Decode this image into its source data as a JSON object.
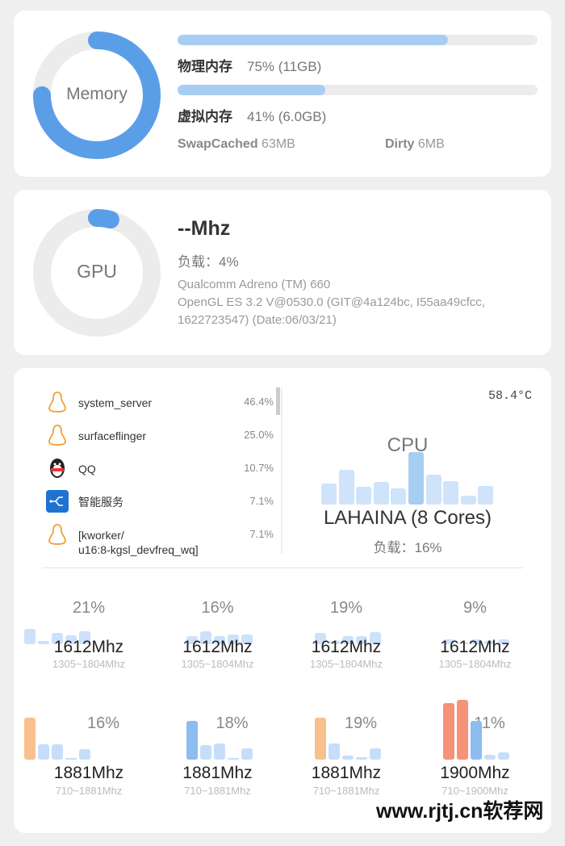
{
  "colors": {
    "accent": "#5b9ee8",
    "track": "#ececec",
    "bar_light": "#c6defa",
    "bar_mid": "#a8cdf3",
    "orange": "#f8c08c",
    "red": "#f59279",
    "blue_dark": "#8dbcf0"
  },
  "memory": {
    "label": "Memory",
    "percent": 75,
    "physical": {
      "label": "物理内存",
      "value": "75% (11GB)",
      "percent": 75
    },
    "virtual": {
      "label": "虚拟内存",
      "value": "41% (6.0GB)",
      "percent": 41
    },
    "swap_cached": {
      "label": "SwapCached",
      "value": "63MB"
    },
    "dirty": {
      "label": "Dirty",
      "value": "6MB"
    }
  },
  "gpu": {
    "label": "GPU",
    "percent": 4,
    "freq": "--Mhz",
    "load": "负载：4%",
    "renderer": "Qualcomm Adreno (TM) 660",
    "gl_version": "OpenGL ES 3.2 V@0530.0 (GIT@4a124bc, I55aa49cfcc, 1622723547) (Date:06/03/21)"
  },
  "cpu": {
    "temperature": "58.4°C",
    "label": "CPU",
    "name": "LAHAINA (8 Cores)",
    "load": "负载：16%",
    "history": [
      37,
      62,
      31,
      40,
      29,
      93,
      53,
      41,
      16,
      33
    ],
    "processes": [
      {
        "icon": "linux-penguin-icon",
        "name": "system_server",
        "percent": "46.4%"
      },
      {
        "icon": "linux-penguin-icon",
        "name": "surfaceflinger",
        "percent": "25.0%"
      },
      {
        "icon": "qq-penguin-icon",
        "name": "QQ",
        "percent": "10.7%"
      },
      {
        "icon": "smart-service-icon",
        "name": "智能服务",
        "percent": "7.1%"
      },
      {
        "icon": "linux-penguin-icon",
        "name": "[kworker/\nu16:8-kgsl_devfreq_wq]",
        "percent": "7.1%"
      }
    ],
    "cores": [
      {
        "percent": "21%",
        "freq": "1612Mhz",
        "range": "1305~1804Mhz",
        "history": [
          36,
          8,
          26,
          21,
          30
        ]
      },
      {
        "percent": "16%",
        "freq": "1612Mhz",
        "range": "1305~1804Mhz",
        "history": [
          19,
          30,
          19,
          23,
          23
        ]
      },
      {
        "percent": "19%",
        "freq": "1612Mhz",
        "range": "1305~1804Mhz",
        "history": [
          26,
          8,
          19,
          19,
          28
        ]
      },
      {
        "percent": "9%",
        "freq": "1612Mhz",
        "range": "1305~1804Mhz",
        "history": [
          11,
          4,
          11,
          8,
          11
        ]
      },
      {
        "percent": "16%",
        "freq": "1881Mhz",
        "range": "710~1881Mhz",
        "history": [
          98,
          36,
          36,
          4,
          25
        ],
        "first_color": "#f8c08c"
      },
      {
        "percent": "18%",
        "freq": "1881Mhz",
        "range": "710~1881Mhz",
        "history": [
          91,
          34,
          38,
          4,
          26
        ],
        "first_color": "#8dbcf0"
      },
      {
        "percent": "19%",
        "freq": "1881Mhz",
        "range": "710~1881Mhz",
        "history": [
          98,
          38,
          9,
          6,
          26
        ],
        "first_color": "#f8c08c"
      },
      {
        "percent": "11%",
        "freq": "1900Mhz",
        "range": "710~1900Mhz",
        "history": [
          132,
          140,
          91,
          11,
          17
        ],
        "colors": [
          "#f59279",
          "#f59279",
          "#8dbcf0"
        ]
      }
    ]
  },
  "watermark": "www.rjtj.cn软荐网"
}
